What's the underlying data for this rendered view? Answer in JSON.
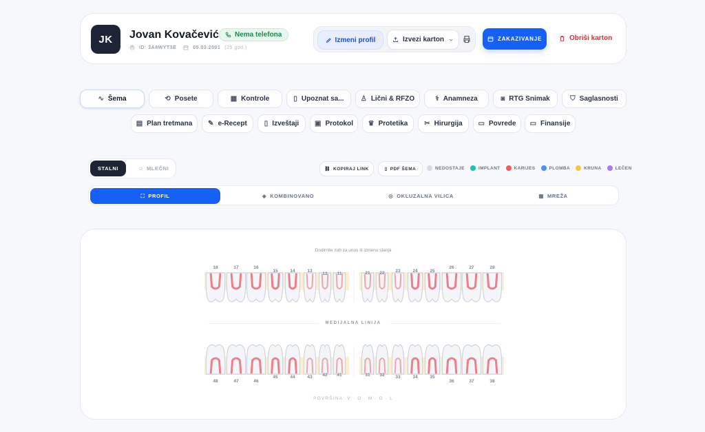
{
  "patient": {
    "initials": "JK",
    "name": "Jovan Kovačević",
    "phone_status": "Nema telefona",
    "id_label": "ID: 3A8WYT3E",
    "dob": "05.03.2001",
    "age": "(25 god.)"
  },
  "header_actions": {
    "edit_label": "Izmeni profil",
    "export_label": "Izvezi karton",
    "schedule_label": "ZAKAZIVANJE",
    "delete_label": "Obriši karton"
  },
  "tabs_row1": [
    {
      "label": "Šema",
      "icon": "pulse-icon"
    },
    {
      "label": "Posete",
      "icon": "history-icon"
    },
    {
      "label": "Kontrole",
      "icon": "calendar-icon"
    },
    {
      "label": "Upoznat sa...",
      "icon": "clipboard-icon"
    },
    {
      "label": "Lični & RFZO",
      "icon": "user-icon"
    },
    {
      "label": "Anamneza",
      "icon": "stethoscope-icon"
    },
    {
      "label": "RTG Snimak",
      "icon": "camera-icon"
    },
    {
      "label": "Saglasnosti",
      "icon": "shield-icon"
    }
  ],
  "tabs_row2": [
    {
      "label": "Plan tretmana",
      "icon": "clipboard-list-icon"
    },
    {
      "label": "e-Recept",
      "icon": "prescription-icon"
    },
    {
      "label": "Izveštaji",
      "icon": "file-icon"
    },
    {
      "label": "Protokol",
      "icon": "book-icon"
    },
    {
      "label": "Protetika",
      "icon": "crown-icon"
    },
    {
      "label": "Hirurgija",
      "icon": "scissors-icon"
    },
    {
      "label": "Povrede",
      "icon": "bandage-icon"
    },
    {
      "label": "Finansije",
      "icon": "card-icon"
    }
  ],
  "dentition": {
    "active": "STALNI",
    "inactive": "MLEČNI"
  },
  "tools": {
    "copy_link": "KOPIRAJ LINK",
    "pdf": "PDF ŠEMA"
  },
  "legend": [
    {
      "label": "NEDOSTAJE",
      "color": "#d6dae3"
    },
    {
      "label": "IMPLANT",
      "color": "#17c3b2"
    },
    {
      "label": "KARIJES",
      "color": "#f25c5c"
    },
    {
      "label": "PLOMBA",
      "color": "#4d8ef7"
    },
    {
      "label": "KRUNA",
      "color": "#f5c842"
    },
    {
      "label": "LEČEN",
      "color": "#a77bf3"
    }
  ],
  "view_tabs": [
    {
      "label": "PROFIL",
      "icon": "scan-icon"
    },
    {
      "label": "KOMBINOVANO",
      "icon": "layers-icon"
    },
    {
      "label": "OKLUZALNA VILICA",
      "icon": "circle-icon"
    },
    {
      "label": "MREŽA",
      "icon": "grid-icon"
    }
  ],
  "chart": {
    "hint": "Dodirnite zub za unos ili izmenu stanja",
    "midline": "MEDIJALNA LINIJA",
    "surface": "POVRŠINA: V · O · M · D · L",
    "upper_left": [
      "18",
      "17",
      "16",
      "15",
      "14",
      "13",
      "12",
      "11"
    ],
    "upper_right": [
      "21",
      "22",
      "23",
      "24",
      "25",
      "26",
      "27",
      "28"
    ],
    "lower_left": [
      "48",
      "47",
      "46",
      "45",
      "44",
      "43",
      "42",
      "41"
    ],
    "lower_right": [
      "31",
      "32",
      "33",
      "34",
      "35",
      "36",
      "37",
      "38"
    ]
  }
}
